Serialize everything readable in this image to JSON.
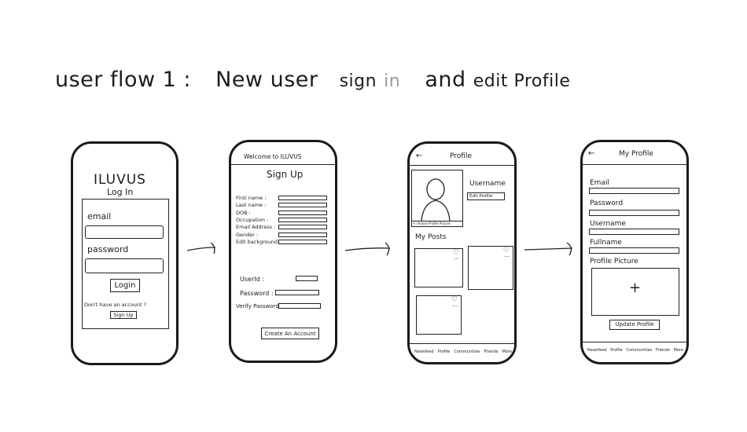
{
  "title": {
    "part1": "user flow 1 :",
    "part2": "New user",
    "part3": "sign",
    "part4": "in",
    "part5": "and",
    "part6": "edit Profile"
  },
  "screen1": {
    "app_name": "ILUVUS",
    "heading": "Log In",
    "email_label": "email",
    "password_label": "password",
    "login_button": "Login",
    "no_account": "Don't have an account ?",
    "signup_button": "Sign Up"
  },
  "screen2": {
    "welcome": "Welcome to ILUVUS",
    "heading": "Sign Up",
    "fields": [
      "First name :",
      "Last name :",
      "DOB :",
      "Occupation :",
      "Email Address :",
      "Gender :",
      "Edit background :"
    ],
    "userid": "UserId :",
    "password": "Password :",
    "verify": "Verify Password :",
    "create_button": "Create An Account"
  },
  "screen3": {
    "back": "←",
    "title": "Profile",
    "username": "Username",
    "edit_profile": "Edit Profile",
    "choose_pic": "+ choose Profile Picture",
    "my_posts": "My Posts",
    "heart": "♡",
    "dots": "...",
    "nav": [
      "Newsfeed",
      "Profile",
      "Communities",
      "Friends",
      "More"
    ]
  },
  "screen4": {
    "back": "←",
    "title": "My Profile",
    "email": "Email",
    "password": "Password",
    "username": "Username",
    "fullname": "Fullname",
    "profile_picture": "Profile Picture",
    "plus": "+",
    "update_button": "Update Profile",
    "nav": [
      "Newsfeed",
      "Profile",
      "Communities",
      "Friends",
      "More"
    ]
  }
}
